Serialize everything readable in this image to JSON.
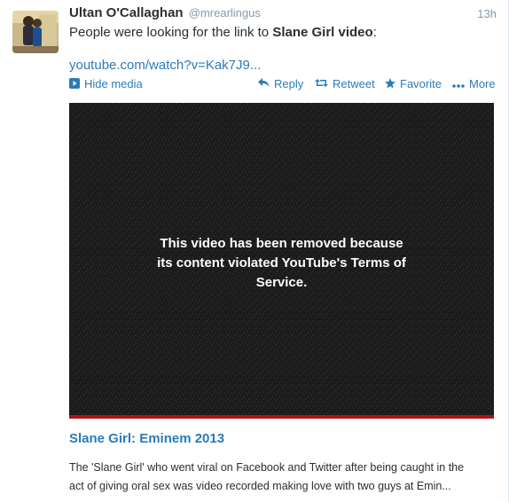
{
  "tweet": {
    "author_name": "Ultan O'Callaghan",
    "author_handle": "@mrearlingus",
    "time": "13h",
    "text_prefix": "People were looking for the link to ",
    "text_bold": "Slane Girl video",
    "text_suffix": ":",
    "link": "youtube.com/watch?v=Kak7J9..."
  },
  "actions": {
    "hide_media": "Hide media",
    "reply": "Reply",
    "retweet": "Retweet",
    "favorite": "Favorite",
    "more": "More"
  },
  "icons": {
    "hide_media": "media-collapse-icon",
    "reply": "reply-arrow-icon",
    "retweet": "retweet-icon",
    "favorite": "star-icon",
    "more": "ellipsis-icon"
  },
  "video": {
    "message_line1": "This video has been removed because",
    "message_line2": "its content violated YouTube's Terms of",
    "message_line3": "Service."
  },
  "card": {
    "title": "Slane Girl: Eminem 2013",
    "description_line1": "The 'Slane Girl' who went viral on Facebook and Twitter after being caught in the",
    "description_line2": "act of giving oral sex was video recorded making love with two guys at Emin..."
  },
  "colors": {
    "link": "#2b7bb9",
    "video_bg": "#1b1b1b",
    "accent_red": "#b31217",
    "muted": "#8899a6"
  }
}
